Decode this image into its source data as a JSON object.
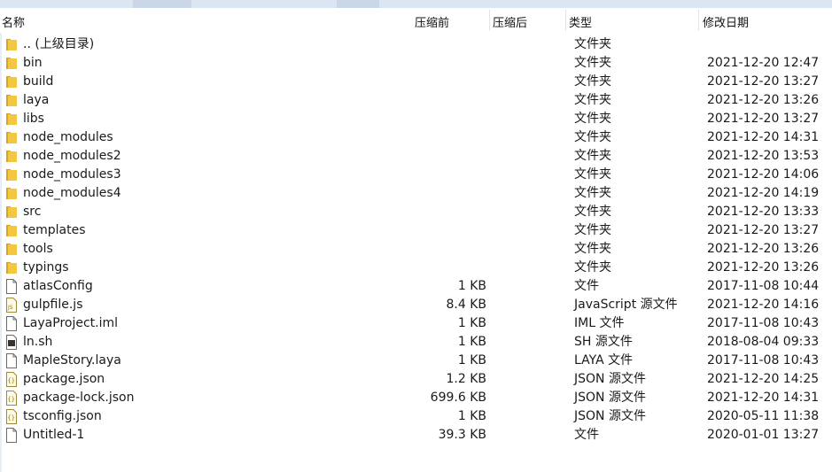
{
  "columns": {
    "name": "名称",
    "packed": "压缩前",
    "compressed": "压缩后",
    "type": "类型",
    "modified": "修改日期"
  },
  "rows": [
    {
      "name": ".. (上级目录)",
      "size": "",
      "type": "文件夹",
      "date": "",
      "icon": "folder-icon"
    },
    {
      "name": "bin",
      "size": "",
      "type": "文件夹",
      "date": "2021-12-20 12:47",
      "icon": "folder-icon"
    },
    {
      "name": "build",
      "size": "",
      "type": "文件夹",
      "date": "2021-12-20 13:27",
      "icon": "folder-icon"
    },
    {
      "name": "laya",
      "size": "",
      "type": "文件夹",
      "date": "2021-12-20 13:26",
      "icon": "folder-icon"
    },
    {
      "name": "libs",
      "size": "",
      "type": "文件夹",
      "date": "2021-12-20 13:27",
      "icon": "folder-icon"
    },
    {
      "name": "node_modules",
      "size": "",
      "type": "文件夹",
      "date": "2021-12-20 14:31",
      "icon": "folder-icon"
    },
    {
      "name": "node_modules2",
      "size": "",
      "type": "文件夹",
      "date": "2021-12-20 13:53",
      "icon": "folder-icon"
    },
    {
      "name": "node_modules3",
      "size": "",
      "type": "文件夹",
      "date": "2021-12-20 14:06",
      "icon": "folder-icon"
    },
    {
      "name": "node_modules4",
      "size": "",
      "type": "文件夹",
      "date": "2021-12-20 14:19",
      "icon": "folder-icon"
    },
    {
      "name": "src",
      "size": "",
      "type": "文件夹",
      "date": "2021-12-20 13:33",
      "icon": "folder-icon"
    },
    {
      "name": "templates",
      "size": "",
      "type": "文件夹",
      "date": "2021-12-20 13:27",
      "icon": "folder-icon"
    },
    {
      "name": "tools",
      "size": "",
      "type": "文件夹",
      "date": "2021-12-20 13:26",
      "icon": "folder-icon"
    },
    {
      "name": "typings",
      "size": "",
      "type": "文件夹",
      "date": "2021-12-20 13:26",
      "icon": "folder-icon"
    },
    {
      "name": "atlasConfig",
      "size": "1 KB",
      "type": "文件",
      "date": "2017-11-08 10:44",
      "icon": "file-icon"
    },
    {
      "name": "gulpfile.js",
      "size": "8.4 KB",
      "type": "JavaScript 源文件",
      "date": "2021-12-20 14:16",
      "icon": "js-file-icon"
    },
    {
      "name": "LayaProject.iml",
      "size": "1 KB",
      "type": "IML 文件",
      "date": "2017-11-08 10:43",
      "icon": "file-icon"
    },
    {
      "name": "ln.sh",
      "size": "1 KB",
      "type": "SH 源文件",
      "date": "2018-08-04 09:33",
      "icon": "shell-file-icon"
    },
    {
      "name": "MapleStory.laya",
      "size": "1 KB",
      "type": "LAYA 文件",
      "date": "2017-11-08 10:43",
      "icon": "file-icon"
    },
    {
      "name": "package.json",
      "size": "1.2 KB",
      "type": "JSON 源文件",
      "date": "2021-12-20 14:25",
      "icon": "json-file-icon"
    },
    {
      "name": "package-lock.json",
      "size": "699.6 KB",
      "type": "JSON 源文件",
      "date": "2021-12-20 14:31",
      "icon": "json-file-icon"
    },
    {
      "name": "tsconfig.json",
      "size": "1 KB",
      "type": "JSON 源文件",
      "date": "2020-05-11 11:38",
      "icon": "json-file-icon"
    },
    {
      "name": "Untitled-1",
      "size": "39.3 KB",
      "type": "文件",
      "date": "2020-01-01 13:27",
      "icon": "file-icon"
    }
  ],
  "colors": {
    "folder": "#f2c744",
    "folder_dark": "#d9a520",
    "header_strip": "#dbe6f3"
  }
}
